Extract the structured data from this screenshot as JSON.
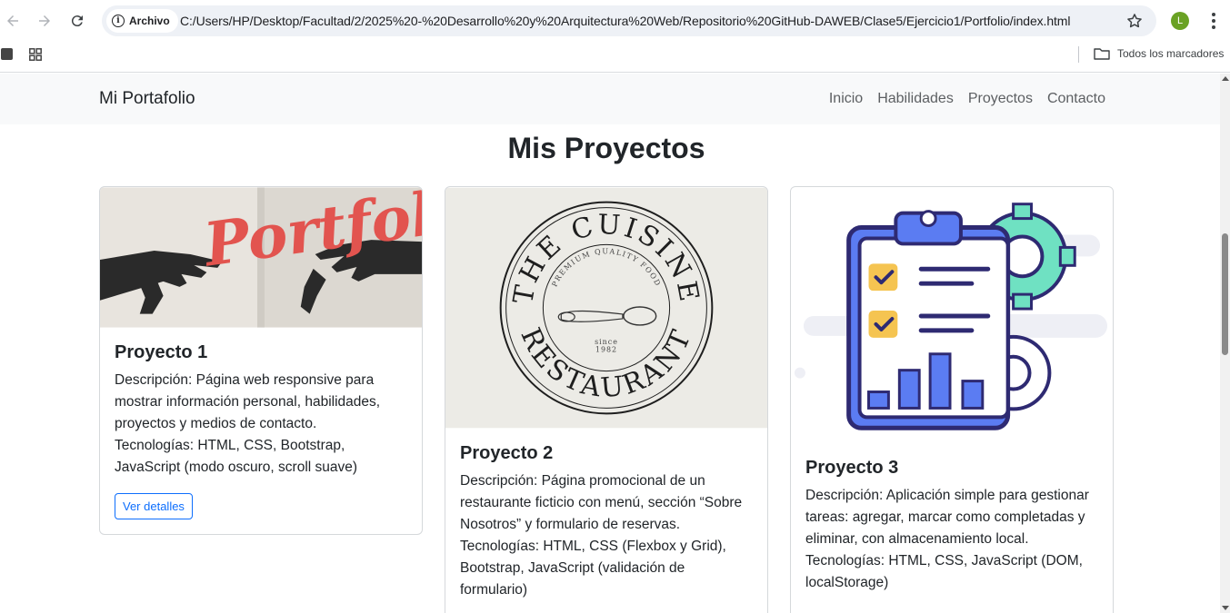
{
  "browser": {
    "site_chip": "Archivo",
    "url": "C:/Users/HP/Desktop/Facultad/2/2025%20-%20Desarrollo%20y%20Arquitectura%20Web/Repositorio%20GitHub-DAWEB/Clase5/Ejercicio1/Portfolio/index.html",
    "profile_initial": "L",
    "bookmarks_folder": "Todos los marcadores"
  },
  "navbar": {
    "brand": "Mi Portafolio",
    "links": [
      "Inicio",
      "Habilidades",
      "Proyectos",
      "Contacto"
    ]
  },
  "section": {
    "title": "Mis Proyectos"
  },
  "projects": [
    {
      "title": "Proyecto 1",
      "description": "Descripción: Página web responsive para mostrar información personal, habilidades, proyectos y medios de contacto.",
      "technologies": "Tecnologías: HTML, CSS, Bootstrap, JavaScript (modo oscuro, scroll suave)",
      "button": "Ver detalles",
      "image_text": "Portfolio"
    },
    {
      "title": "Proyecto 2",
      "description": "Descripción: Página promocional de un restaurante ficticio con menú, sección “Sobre Nosotros” y formulario de reservas.",
      "technologies": "Tecnologías: HTML, CSS (Flexbox y Grid), Bootstrap, JavaScript (validación de formulario)",
      "logo_top": "THE CUISINE",
      "logo_bottom": "RESTAURANT",
      "logo_sub": "PREMIUM QUALITY FOOD",
      "logo_since": "since",
      "logo_year": "1982"
    },
    {
      "title": "Proyecto 3",
      "description": "Descripción: Aplicación simple para gestionar tareas: agregar, marcar como completadas y eliminar, con almacenamiento local.",
      "technologies": "Tecnologías: HTML, CSS, JavaScript (DOM, localStorage)"
    }
  ],
  "colors": {
    "primary": "#0d6efd",
    "navbar_bg": "#f8f9fa",
    "portfolio_red": "#e2544f",
    "clipboard_blue": "#5b7cf2",
    "clipboard_outline": "#2e2a72",
    "gear_green": "#6fe1c2",
    "check_yellow": "#f5c451"
  }
}
